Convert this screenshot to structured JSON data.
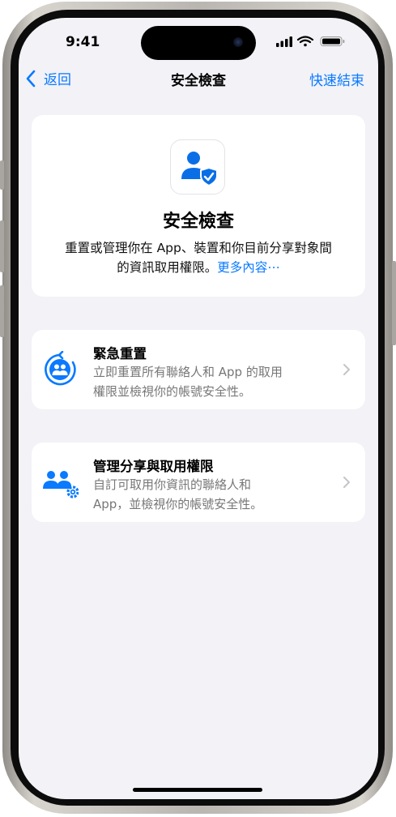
{
  "status_bar": {
    "time": "9:41"
  },
  "nav": {
    "back_label": "返回",
    "title": "安全檢查",
    "quick_exit_label": "快速結束"
  },
  "hero": {
    "title": "安全檢查",
    "description_line1": "重置或管理你在 App、裝置和你目前分享對象間",
    "description_line2_prefix": "的資訊取用權限。",
    "more_link": "更多內容⋯"
  },
  "options": [
    {
      "title": "緊急重置",
      "desc_line1": "立即重置所有聯絡人和 App 的取用",
      "desc_line2": "權限並檢視你的帳號安全性。",
      "icon": "emergency-reset-icon"
    },
    {
      "title": "管理分享與取用權限",
      "desc_line1": "自訂可取用你資訊的聯絡人和",
      "desc_line2": "App，並檢視你的帳號安全性。",
      "icon": "manage-sharing-icon"
    }
  ],
  "colors": {
    "accent": "#0A7AFF",
    "background": "#F2F2F7",
    "card": "#FFFFFF",
    "secondary_text": "#777777"
  }
}
